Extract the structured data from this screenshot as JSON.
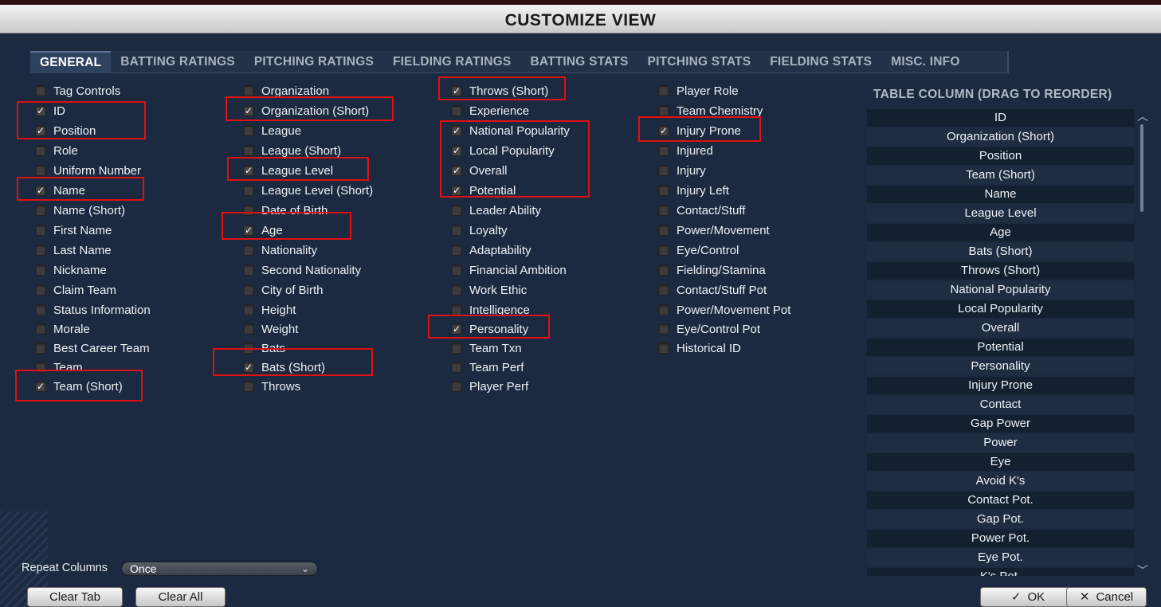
{
  "window": {
    "title": "CUSTOMIZE VIEW"
  },
  "tabs": [
    {
      "label": "GENERAL",
      "active": true
    },
    {
      "label": "BATTING RATINGS",
      "active": false
    },
    {
      "label": "PITCHING RATINGS",
      "active": false
    },
    {
      "label": "FIELDING RATINGS",
      "active": false
    },
    {
      "label": "BATTING STATS",
      "active": false
    },
    {
      "label": "PITCHING STATS",
      "active": false
    },
    {
      "label": "FIELDING STATS",
      "active": false
    },
    {
      "label": "MISC. INFO",
      "active": false
    }
  ],
  "options": {
    "col1": [
      {
        "label": "Tag Controls",
        "checked": false
      },
      {
        "label": "ID",
        "checked": true
      },
      {
        "label": "Position",
        "checked": true
      },
      {
        "label": "Role",
        "checked": false
      },
      {
        "label": "Uniform Number",
        "checked": false
      },
      {
        "label": "Name",
        "checked": true
      },
      {
        "label": "Name (Short)",
        "checked": false
      },
      {
        "label": "First Name",
        "checked": false
      },
      {
        "label": "Last Name",
        "checked": false
      },
      {
        "label": "Nickname",
        "checked": false
      },
      {
        "label": "Claim Team",
        "checked": false
      },
      {
        "label": "Status Information",
        "checked": false
      },
      {
        "label": "Morale",
        "checked": false
      },
      {
        "label": "Best Career Team",
        "checked": false
      },
      {
        "label": "Team",
        "checked": false
      },
      {
        "label": "Team (Short)",
        "checked": true
      }
    ],
    "col2": [
      {
        "label": "Organization",
        "checked": false
      },
      {
        "label": "Organization (Short)",
        "checked": true
      },
      {
        "label": "League",
        "checked": false
      },
      {
        "label": "League (Short)",
        "checked": false
      },
      {
        "label": "League Level",
        "checked": true
      },
      {
        "label": "League Level (Short)",
        "checked": false
      },
      {
        "label": "Date of Birth",
        "checked": false
      },
      {
        "label": "Age",
        "checked": true
      },
      {
        "label": "Nationality",
        "checked": false
      },
      {
        "label": "Second Nationality",
        "checked": false
      },
      {
        "label": "City of Birth",
        "checked": false
      },
      {
        "label": "Height",
        "checked": false
      },
      {
        "label": "Weight",
        "checked": false
      },
      {
        "label": "Bats",
        "checked": false
      },
      {
        "label": "Bats (Short)",
        "checked": true
      },
      {
        "label": "Throws",
        "checked": false
      }
    ],
    "col3": [
      {
        "label": "Throws (Short)",
        "checked": true
      },
      {
        "label": "Experience",
        "checked": false
      },
      {
        "label": "National Popularity",
        "checked": true
      },
      {
        "label": "Local Popularity",
        "checked": true
      },
      {
        "label": "Overall",
        "checked": true
      },
      {
        "label": "Potential",
        "checked": true
      },
      {
        "label": "Leader Ability",
        "checked": false
      },
      {
        "label": "Loyalty",
        "checked": false
      },
      {
        "label": "Adaptability",
        "checked": false
      },
      {
        "label": "Financial Ambition",
        "checked": false
      },
      {
        "label": "Work Ethic",
        "checked": false
      },
      {
        "label": "Intelligence",
        "checked": false
      },
      {
        "label": "Personality",
        "checked": true
      },
      {
        "label": "Team Txn",
        "checked": false
      },
      {
        "label": "Team Perf",
        "checked": false
      },
      {
        "label": "Player Perf",
        "checked": false
      }
    ],
    "col4": [
      {
        "label": "Player Role",
        "checked": false
      },
      {
        "label": "Team Chemistry",
        "checked": false
      },
      {
        "label": "Injury Prone",
        "checked": true
      },
      {
        "label": "Injured",
        "checked": false
      },
      {
        "label": "Injury",
        "checked": false
      },
      {
        "label": "Injury Left",
        "checked": false
      },
      {
        "label": "Contact/Stuff",
        "checked": false
      },
      {
        "label": "Power/Movement",
        "checked": false
      },
      {
        "label": "Eye/Control",
        "checked": false
      },
      {
        "label": "Fielding/Stamina",
        "checked": false
      },
      {
        "label": "Contact/Stuff Pot",
        "checked": false
      },
      {
        "label": "Power/Movement Pot",
        "checked": false
      },
      {
        "label": "Eye/Control Pot",
        "checked": false
      },
      {
        "label": "Historical ID",
        "checked": false
      }
    ]
  },
  "table_columns": {
    "title": "TABLE COLUMN (DRAG TO REORDER)",
    "items": [
      "ID",
      "Organization (Short)",
      "Position",
      "Team (Short)",
      "Name",
      "League Level",
      "Age",
      "Bats (Short)",
      "Throws (Short)",
      "National Popularity",
      "Local Popularity",
      "Overall",
      "Potential",
      "Personality",
      "Injury Prone",
      "Contact",
      "Gap Power",
      "Power",
      "Eye",
      "Avoid K's",
      "Contact Pot.",
      "Gap Pot.",
      "Power Pot.",
      "Eye Pot.",
      "K's Pot."
    ]
  },
  "repeat_columns": {
    "label": "Repeat Columns",
    "value": "Once"
  },
  "buttons": {
    "clear_tab": "Clear Tab",
    "clear_all": "Clear All",
    "ok": "OK",
    "cancel": "Cancel"
  },
  "icons": {
    "check": "✓",
    "close": "✕",
    "chevron_down": "⌄"
  },
  "colors": {
    "background": "#1b2a40",
    "highlight": "#e01010",
    "title_bar": "#dcdcdc"
  }
}
